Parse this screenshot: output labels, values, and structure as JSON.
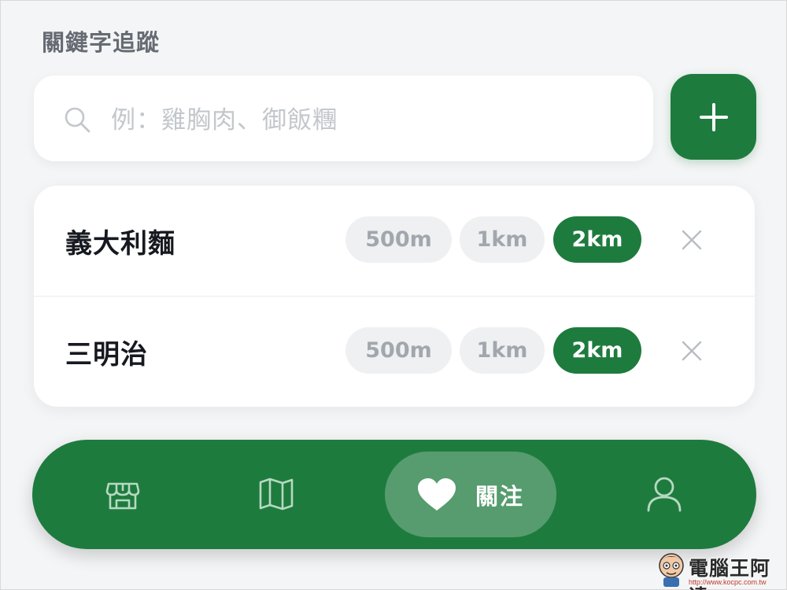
{
  "header": {
    "title": "關鍵字追蹤"
  },
  "search": {
    "placeholder": "例：雞胸肉、御飯糰",
    "value": ""
  },
  "add_button": {
    "icon": "plus-icon"
  },
  "keywords": [
    {
      "label": "義大利麵",
      "ranges": [
        "500m",
        "1km",
        "2km"
      ],
      "selected": "2km"
    },
    {
      "label": "三明治",
      "ranges": [
        "500m",
        "1km",
        "2km"
      ],
      "selected": "2km"
    }
  ],
  "nav": {
    "items": [
      {
        "icon": "store-icon",
        "label": ""
      },
      {
        "icon": "map-icon",
        "label": ""
      },
      {
        "icon": "heart-icon",
        "label": "關注",
        "active": true
      },
      {
        "icon": "user-icon",
        "label": ""
      }
    ]
  },
  "watermark": {
    "text": "電腦王阿達",
    "url": "http://www.kocpc.com.tw"
  },
  "colors": {
    "accent": "#1e7b3e",
    "background": "#f4f5f6",
    "chip_inactive": "#eff0f2"
  }
}
